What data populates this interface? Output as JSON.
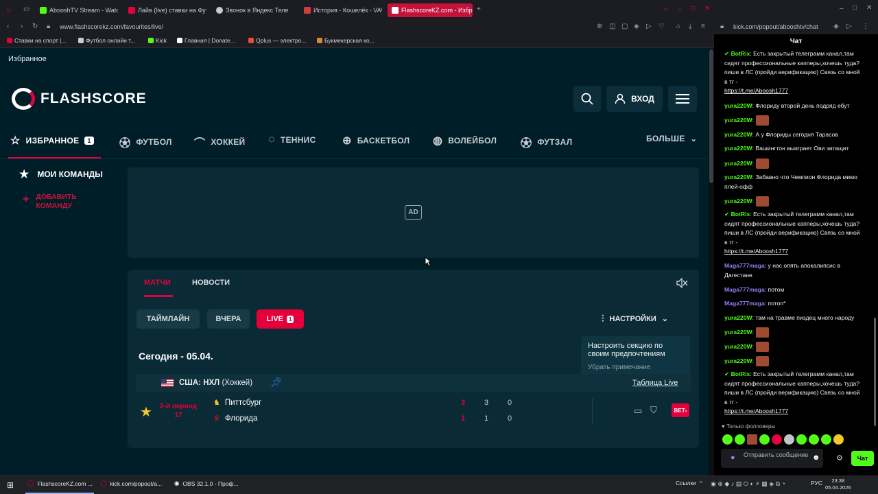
{
  "browser": {
    "tabs": [
      {
        "label": "AbooshTV Stream - Watch",
        "color": "#53fc18"
      },
      {
        "label": "Лайв (live) ставки на Фут",
        "color": "#e4003b"
      },
      {
        "label": "Звонок в Яндекс Теле",
        "color": "#c9cbd1"
      },
      {
        "label": "История - Кошелёк - VAV",
        "color": "#d23c3c"
      },
      {
        "label": "FlashscoreKZ.com - Избр",
        "color": "#e4003b"
      }
    ],
    "url": "www.flashscorekz.com/favourites/live/",
    "chat_url": "kick.com/popout/abooshtv/chat",
    "bookmarks": [
      {
        "label": "Ставки на спорт |...",
        "color": "#e4003b"
      },
      {
        "label": "Футбол онлайн т...",
        "color": "#cccccc"
      },
      {
        "label": "Kick",
        "color": "#53fc18"
      },
      {
        "label": "Главная | Donate...",
        "color": "#ffffff"
      },
      {
        "label": "Qplus — электро...",
        "color": "#e0503b"
      },
      {
        "label": "Букмекерская ко...",
        "color": "#d08a3b"
      }
    ]
  },
  "page": {
    "section_title": "Избранное",
    "logo": "FLASHSCORE",
    "login_label": "ВХОД",
    "nav": [
      {
        "label": "ИЗБРАННОЕ",
        "badge": "1",
        "icon": "star-icon"
      },
      {
        "label": "ФУТБОЛ",
        "icon": "soccer-ball-icon"
      },
      {
        "label": "ХОККЕЙ",
        "icon": "hockey-icon"
      },
      {
        "label": "ТЕННИС",
        "icon": "tennis-icon"
      },
      {
        "label": "БАСКЕТБОЛ",
        "icon": "basketball-icon"
      },
      {
        "label": "ВОЛЕЙБОЛ",
        "icon": "volleyball-icon"
      },
      {
        "label": "ФУТЗАЛ",
        "icon": "futsal-icon"
      }
    ],
    "more_label": "БОЛЬШЕ",
    "my_teams": "МОИ КОМАНДЫ",
    "add_team_line1": "ДОБАВИТЬ",
    "add_team_line2": "КОМАНДУ",
    "ad_badge": "AD",
    "subtabs": {
      "matches": "МАТЧИ",
      "news": "НОВОСТИ"
    },
    "filters": {
      "timeline": "ТАЙМЛАЙН",
      "yesterday": "ВЧЕРА",
      "live": "LIVE",
      "live_count": "1"
    },
    "settings_label": "НАСТРОЙКИ",
    "tooltip": {
      "text": "Настроить секцию по своим предпочтениям",
      "dismiss": "Убрать примечание"
    },
    "date_heading": "Сегодня - 05.04.",
    "league": {
      "country": "США: НХЛ",
      "sport": "(Хоккей)",
      "table_link": "Таблица Live"
    },
    "match": {
      "period": "2-й период",
      "minute": "17",
      "home": "Питтсбург",
      "away": "Флорида",
      "home_total": "3",
      "home_p1": "3",
      "home_p2": "0",
      "away_total": "1",
      "away_p1": "1",
      "away_p2": "0",
      "bet_label": "BET"
    }
  },
  "chat": {
    "title": "Чат",
    "messages": [
      {
        "user": "BotRix",
        "color": "#53fc18",
        "text": ": Есть закрытый телеграмм канал,там сидят профессиональные капперы,хочешь туда? пиши в ЛС (пройди верификацию) Связь со мной в тг - ",
        "link": "https://t.me/Aboosh1777"
      },
      {
        "user": "yura220W",
        "color": "#53fc18",
        "text": ": Флориду второй день подряд ебут"
      },
      {
        "user": "yura220W",
        "color": "#53fc18",
        "text": ":",
        "emote": true
      },
      {
        "user": "yura220W",
        "color": "#53fc18",
        "text": ": А у Флориды сегодня Тарасов"
      },
      {
        "user": "yura220W",
        "color": "#53fc18",
        "text": ": Вашингтон выиграет Ови затащит"
      },
      {
        "user": "yura220W",
        "color": "#53fc18",
        "text": ":",
        "emote": true
      },
      {
        "user": "yura220W",
        "color": "#53fc18",
        "text": ": Забавно что Чемпион Флорида мимо плей-офф"
      },
      {
        "user": "yura220W",
        "color": "#53fc18",
        "text": ":",
        "emote": true
      },
      {
        "user": "BotRix",
        "color": "#53fc18",
        "text": ": Есть закрытый телеграмм канал,там сидят профессиональные капперы,хочешь туда? пиши в ЛС (пройди верификацию) Связь со мной в тг - ",
        "link": "https://t.me/Aboosh1777"
      },
      {
        "user": "Maga777maga",
        "color": "#9b7df8",
        "text": ": у нас опять апокалипсис в Дагестане"
      },
      {
        "user": "Maga777maga",
        "color": "#9b7df8",
        "text": ": потом"
      },
      {
        "user": "Maga777maga",
        "color": "#9b7df8",
        "text": ": потоп*"
      },
      {
        "user": "yura220W",
        "color": "#53fc18",
        "text": ": там на травме пиздец много народу"
      },
      {
        "user": "yura220W",
        "color": "#53fc18",
        "text": ":",
        "emote": true
      },
      {
        "user": "yura220W",
        "color": "#53fc18",
        "text": ":",
        "emote": true
      },
      {
        "user": "yura220W",
        "color": "#53fc18",
        "text": ":",
        "emote": true
      },
      {
        "user": "BotRix",
        "color": "#53fc18",
        "text": ": Есть закрытый телеграмм канал,там сидят профессиональные капперы,хочешь туда? пиши в ЛС (пройди верификацию) Связь со мной в тг - ",
        "link": "https://t.me/Aboosh1777"
      }
    ],
    "followers_only": "Только фолловеры",
    "input_placeholder": "Отправить сообщение",
    "send_label": "Чат"
  },
  "taskbar": {
    "items": [
      {
        "label": "FlashscoreKZ.com ..."
      },
      {
        "label": "kick.com/popout/a..."
      },
      {
        "label": "OBS 32.1.0 - Проф..."
      }
    ],
    "links_label": "Ссылки",
    "lang": "РУС",
    "time": "23:38",
    "date": "05.04.2026"
  }
}
